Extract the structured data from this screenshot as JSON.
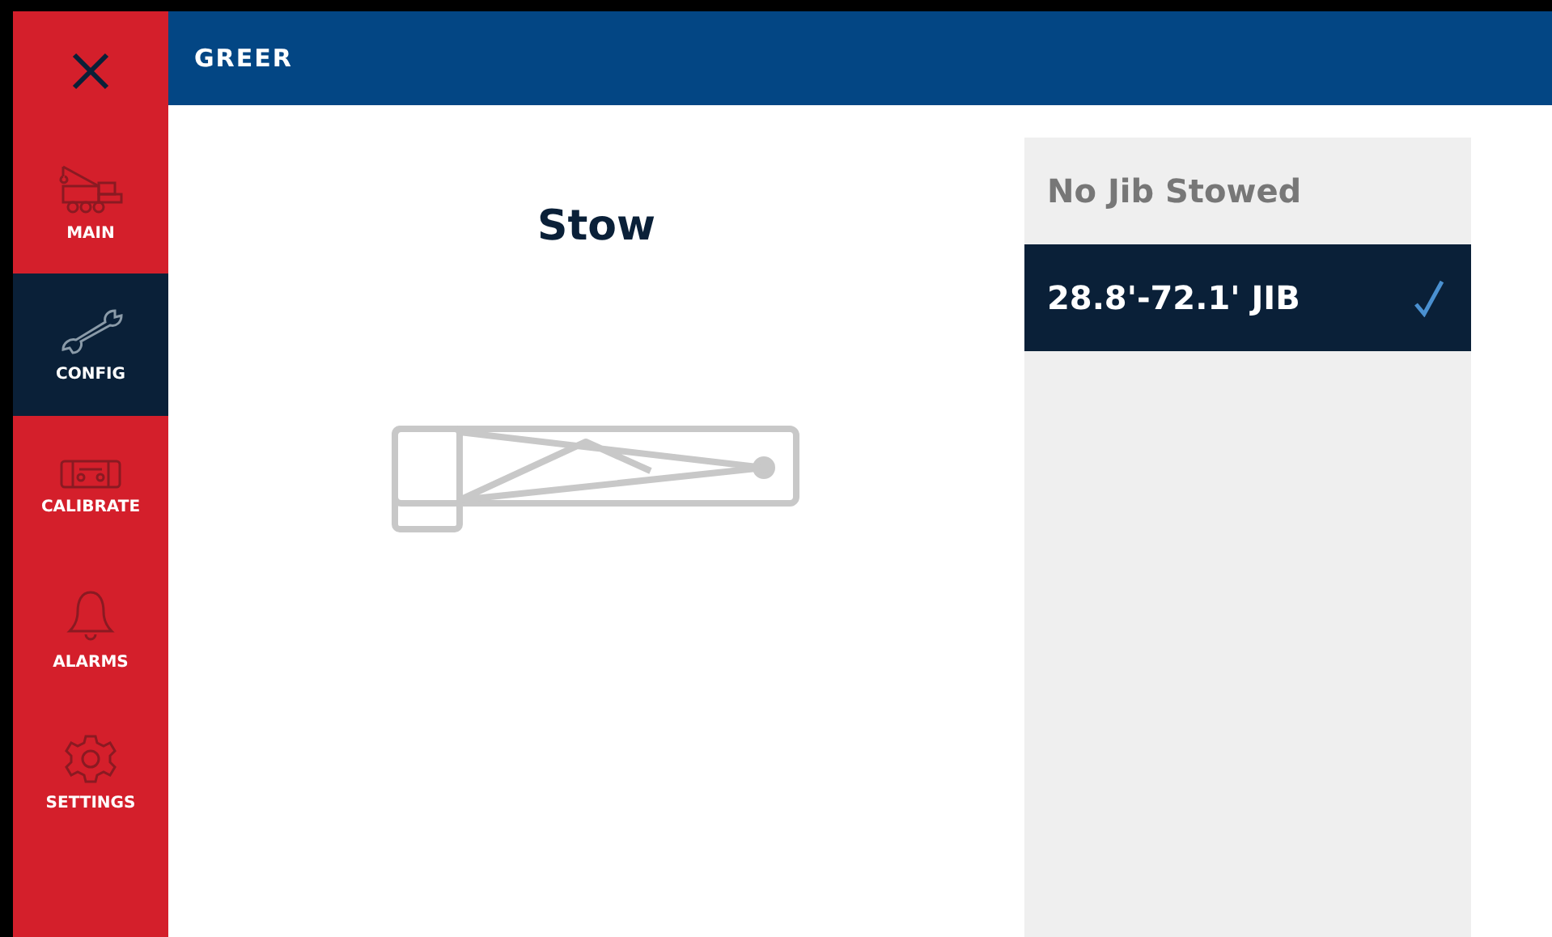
{
  "header": {
    "title": "GREER"
  },
  "sidebar": {
    "items": [
      {
        "label": "MAIN",
        "kind": "crane",
        "selected": false
      },
      {
        "label": "CONFIG",
        "kind": "wrench",
        "selected": true
      },
      {
        "label": "CALIBRATE",
        "kind": "level",
        "selected": false
      },
      {
        "label": "ALARMS",
        "kind": "bell",
        "selected": false
      },
      {
        "label": "SETTINGS",
        "kind": "gear",
        "selected": false
      }
    ]
  },
  "main": {
    "title": "Stow"
  },
  "options": [
    {
      "label": "No Jib Stowed",
      "selected": false
    },
    {
      "label": "28.8'-72.1' JIB",
      "selected": true
    }
  ]
}
